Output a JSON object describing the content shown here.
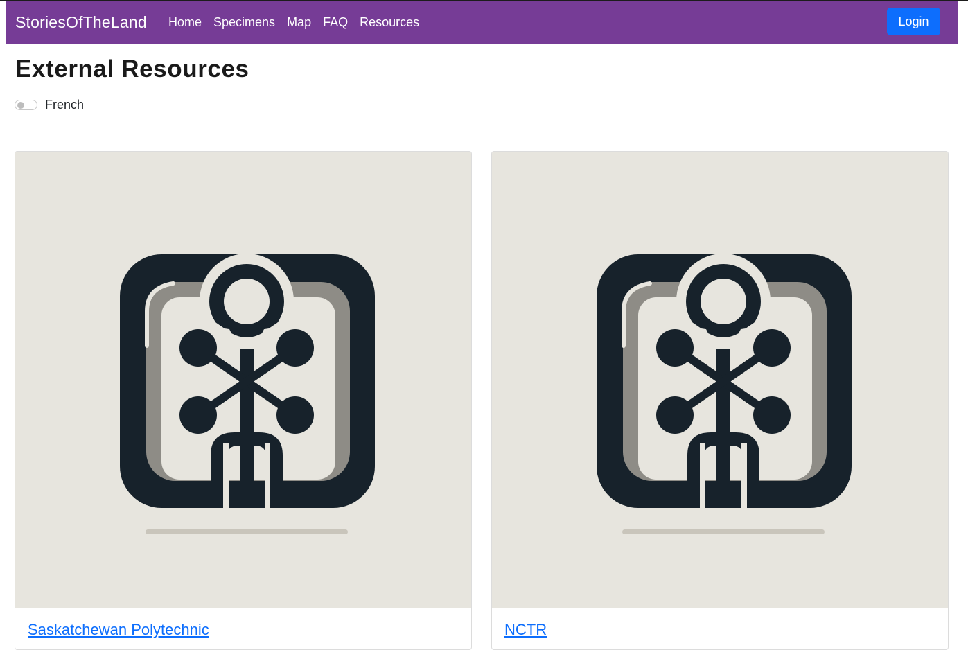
{
  "navbar": {
    "brand": "StoriesOfTheLand",
    "links": [
      {
        "label": "Home"
      },
      {
        "label": "Specimens"
      },
      {
        "label": "Map"
      },
      {
        "label": "FAQ"
      },
      {
        "label": "Resources"
      }
    ],
    "login_label": "Login"
  },
  "page": {
    "title": "External Resources",
    "toggle_label": "French",
    "toggle_on": false
  },
  "cards": [
    {
      "link_text": "Saskatchewan Polytechnic",
      "image_icon": "resource-logo-icon"
    },
    {
      "link_text": "NCTR",
      "image_icon": "resource-logo-icon"
    }
  ],
  "colors": {
    "navbar": "#763c96",
    "login_button": "#0d6efd",
    "link": "#0d6efd",
    "card_image_bg": "#e7e5de",
    "logo_dark": "#17222b",
    "logo_gray": "#8e8c86"
  }
}
